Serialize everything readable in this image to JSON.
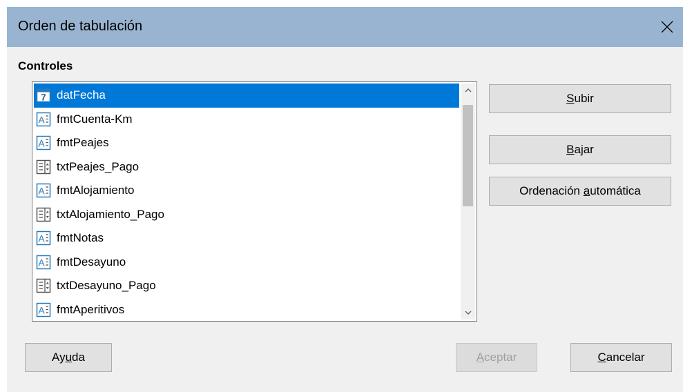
{
  "dialog": {
    "title": "Orden de tabulación",
    "section_label": "Controles"
  },
  "list": {
    "items": [
      {
        "label": "datFecha",
        "icon": "date-field-icon",
        "selected": true
      },
      {
        "label": "fmtCuenta-Km",
        "icon": "formatted-field-icon",
        "selected": false
      },
      {
        "label": "fmtPeajes",
        "icon": "formatted-field-icon",
        "selected": false
      },
      {
        "label": "txtPeajes_Pago",
        "icon": "numeric-field-icon",
        "selected": false
      },
      {
        "label": "fmtAlojamiento",
        "icon": "formatted-field-icon",
        "selected": false
      },
      {
        "label": "txtAlojamiento_Pago",
        "icon": "numeric-field-icon",
        "selected": false
      },
      {
        "label": "fmtNotas",
        "icon": "formatted-field-icon",
        "selected": false
      },
      {
        "label": "fmtDesayuno",
        "icon": "formatted-field-icon",
        "selected": false
      },
      {
        "label": "txtDesayuno_Pago",
        "icon": "numeric-field-icon",
        "selected": false
      },
      {
        "label": "fmtAperitivos",
        "icon": "formatted-field-icon",
        "selected": false
      }
    ]
  },
  "buttons": {
    "subir": {
      "mnemonic": "S",
      "rest": "ubir"
    },
    "bajar": {
      "mnemonic": "B",
      "rest": "ajar"
    },
    "auto": {
      "pre": "Ordenación ",
      "mnemonic": "a",
      "rest": "utomática"
    },
    "ayuda": {
      "pre": "Ay",
      "mnemonic": "u",
      "rest": "da"
    },
    "aceptar": {
      "mnemonic": "A",
      "rest": "ceptar"
    },
    "cancelar": {
      "mnemonic": "C",
      "rest": "ancelar"
    }
  },
  "colors": {
    "titlebar": "#99b4d1",
    "selection": "#0078d7",
    "icon_blue": "#2a7ab8"
  }
}
